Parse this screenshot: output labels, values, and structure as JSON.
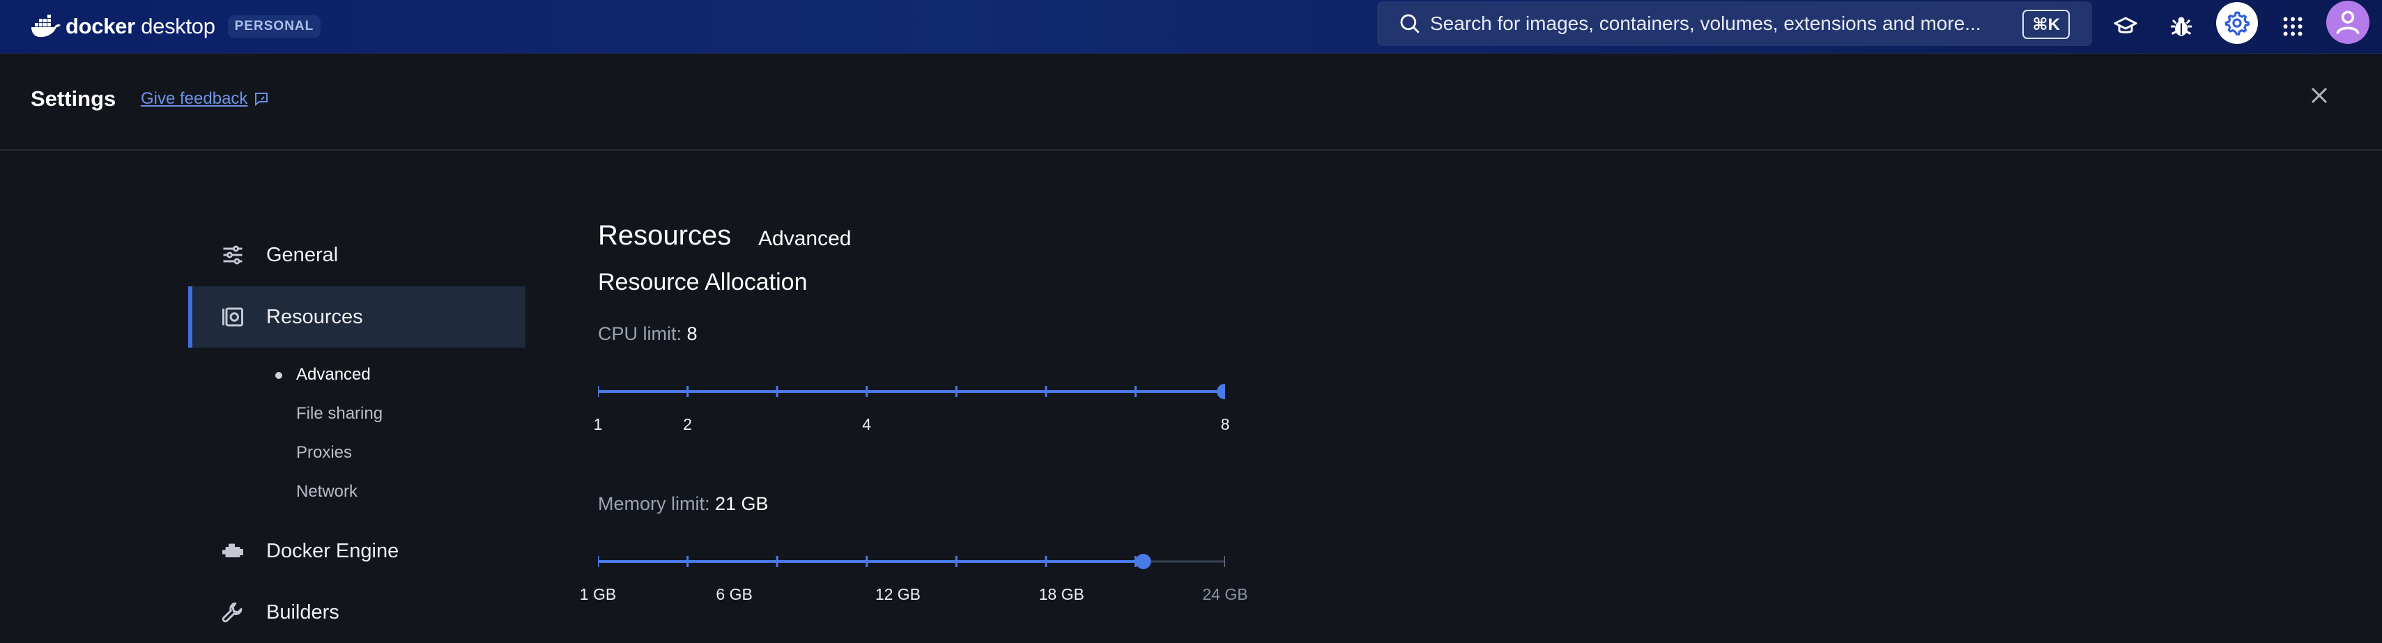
{
  "topbar": {
    "logo_bold": "docker",
    "logo_light": "desktop",
    "plan": "PERSONAL",
    "search_placeholder": "Search for images, containers, volumes, extensions and more...",
    "search_shortcut": "⌘K"
  },
  "header": {
    "title": "Settings",
    "feedback_label": "Give feedback"
  },
  "sidebar": {
    "items": [
      {
        "label": "General",
        "icon": "sliders-icon"
      },
      {
        "label": "Resources",
        "icon": "disk-icon",
        "active": true
      },
      {
        "label": "Docker Engine",
        "icon": "engine-icon"
      },
      {
        "label": "Builders",
        "icon": "wrench-icon"
      }
    ],
    "sub_items": [
      {
        "label": "Advanced",
        "active": true
      },
      {
        "label": "File sharing"
      },
      {
        "label": "Proxies"
      },
      {
        "label": "Network"
      }
    ]
  },
  "main": {
    "title": "Resources",
    "tab": "Advanced",
    "section_title": "Resource Allocation",
    "cpu": {
      "label": "CPU limit:",
      "value": "8",
      "min": 1,
      "max": 8,
      "current": 8,
      "tick_labels": [
        "1",
        "2",
        "4",
        "8"
      ]
    },
    "memory": {
      "label": "Memory limit:",
      "value": "21 GB",
      "min": 1,
      "max": 24,
      "current": 21,
      "tick_labels": [
        "1 GB",
        "6 GB",
        "12 GB",
        "18 GB",
        "24 GB"
      ]
    }
  },
  "colors": {
    "accent": "#3d6fe0",
    "slider_track": "#4a7ae8",
    "background": "#12151b",
    "topbar": "#0f246a"
  }
}
